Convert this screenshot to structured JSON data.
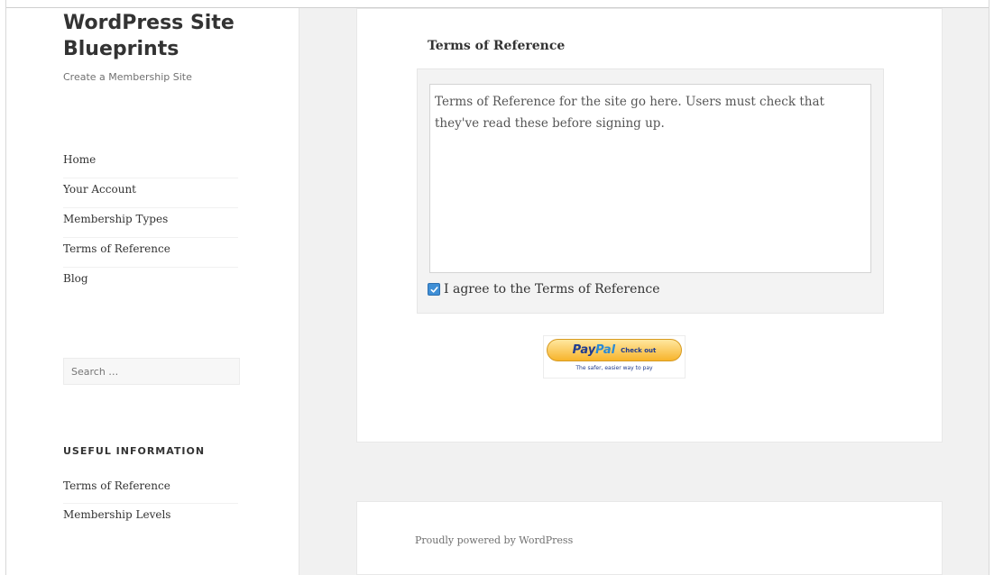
{
  "site": {
    "title": "WordPress Site Blueprints",
    "description": "Create a Membership Site"
  },
  "nav": {
    "items": [
      {
        "label": "Home"
      },
      {
        "label": "Your Account"
      },
      {
        "label": "Membership Types"
      },
      {
        "label": "Terms of Reference"
      },
      {
        "label": "Blog"
      }
    ]
  },
  "search": {
    "placeholder": "Search …"
  },
  "widget": {
    "title": "USEFUL INFORMATION",
    "items": [
      {
        "label": "Terms of Reference"
      },
      {
        "label": "Membership Levels"
      }
    ]
  },
  "main": {
    "tor_heading": "Terms of Reference",
    "tor_text": "Terms of Reference for the site go here. Users must check that they've read these before signing up.",
    "agree_label": "I agree to the Terms of Reference",
    "agree_checked": true
  },
  "paypal": {
    "logo_pay": "Pay",
    "logo_pal": "Pal",
    "checkout": "Check out",
    "tagline": "The safer, easier way to pay"
  },
  "footer": {
    "text": "Proudly powered by WordPress"
  }
}
